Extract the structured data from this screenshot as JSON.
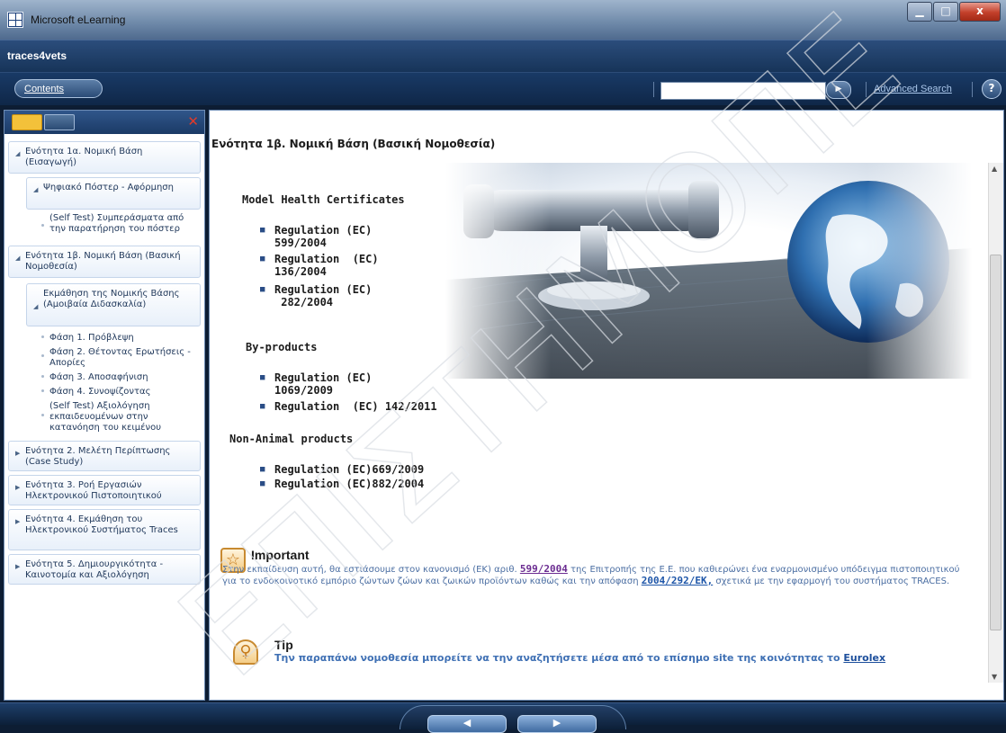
{
  "window": {
    "title": "Microsoft eLearning",
    "minimize": "▁",
    "maximize": "□",
    "close": "x"
  },
  "app": {
    "name": "traces4vets"
  },
  "toolbar": {
    "contents_label": "Contents",
    "search_placeholder": "",
    "search_go": "▶",
    "advanced_search": "Advanced Search",
    "help": "?"
  },
  "sidebar": {
    "tabs": [
      "list-view",
      "grid-view"
    ],
    "close": "✕",
    "items": [
      {
        "label": "Ενότητα 1α. Νομική Βάση (Εισαγωγή)",
        "expanded": true
      },
      {
        "label": "Ψηφιακό Πόστερ - Αφόρμηση",
        "expanded": true,
        "level": 1
      },
      {
        "label": "(Self Test) Συμπεράσματα από την παρατήρηση του πόστερ",
        "level": 2
      },
      {
        "label": "Ενότητα 1β. Νομική Βάση (Βασική Νομοθεσία)",
        "expanded": true
      },
      {
        "label": "Εκμάθηση της Νομικής Βάσης (Αμοιβαία Διδασκαλία)",
        "expanded": true,
        "level": 1
      },
      {
        "label": "Φάση 1. Πρόβλεψη",
        "level": 2
      },
      {
        "label": "Φάση 2. Θέτοντας Ερωτήσεις - Απορίες",
        "level": 2
      },
      {
        "label": "Φάση 3. Αποσαφήνιση",
        "level": 2
      },
      {
        "label": "Φάση 4. Συνοψίζοντας",
        "level": 2
      },
      {
        "label": "(Self Test) Αξιολόγηση εκπαιδευομένων στην κατανόηση του κειμένου",
        "level": 2
      },
      {
        "label": "Ενότητα 2. Μελέτη Περίπτωσης (Case Study)"
      },
      {
        "label": "Ενότητα 3. Ροή Εργασιών Ηλεκτρονικού Πιστοποιητικού"
      },
      {
        "label": "Ενότητα 4. Εκμάθηση του Ηλεκτρονικού Συστήματος Traces"
      },
      {
        "label": "Ενότητα 5. Δημιουργικότητα - Καινοτομία και Αξιολόγηση"
      }
    ]
  },
  "main": {
    "title": "Ενότητα 1β. Νομική Βάση (Βασική Νομοθεσία)",
    "sections": [
      {
        "heading": "Model Health Certificates",
        "items": [
          "Regulation (EC)\n599/2004",
          "Regulation  (EC)\n136/2004",
          "Regulation (EC)\n 282/2004"
        ]
      },
      {
        "heading": "By-products",
        "items": [
          "Regulation (EC)\n1069/2009",
          "Regulation  (EC) 142/2011"
        ]
      },
      {
        "heading": "Non-Animal products",
        "items": [
          "Regulation (EC)669/2009",
          "Regulation (EC)882/2004"
        ]
      }
    ],
    "important": {
      "heading": "Important",
      "text_1": "Στην εκπαίδευση αυτή, θα εστιάσουμε στον κανονισμό  (ΕΚ) αριθ. ",
      "link_1": "599/2004",
      "text_2": " της Επιτροπής της Ε.Ε. που καθιερώνει ένα εναρμονισμένο υπόδειγμα πιστοποιητικού για το ενδοκοινοτικό εμπόριο ζώντων ζώων και ζωικών προϊόντων καθώς και την απόφαση ",
      "link_2": "2004/292/ΕΚ,",
      "text_3": " σχετικά με την εφαρμογή του συστήματος TRACES."
    },
    "tip": {
      "heading": "Tip",
      "text": "Την παραπάνω νομοθεσία μπορείτε να την αναζητήσετε μέσα από το επίσημο site της κοινότητας το ",
      "link": "Eurolex"
    }
  },
  "nav": {
    "prev": "◀",
    "next": "▶"
  },
  "colors": {
    "accent": "#1b3a66",
    "link_purple": "#6b2c91",
    "text_blue": "#4c6fa3",
    "highlight": "#f3c13a"
  },
  "watermark": {
    "text": "ΕΠΙΣΤΗΜΟΠΕ"
  }
}
